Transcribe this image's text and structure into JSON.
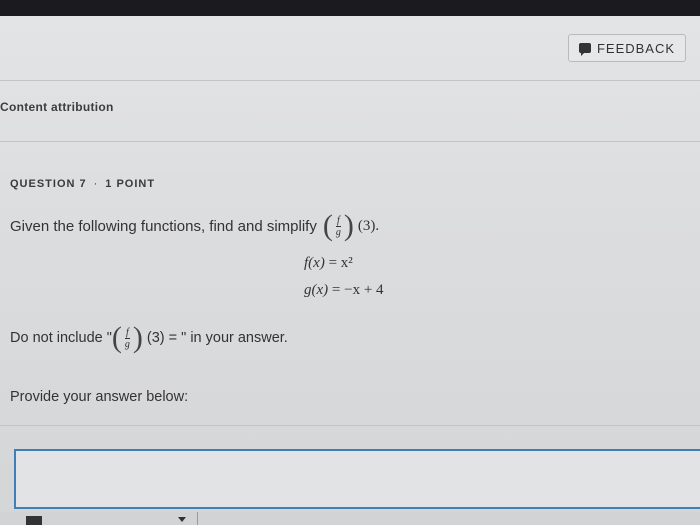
{
  "header": {
    "feedback_label": "FEEDBACK"
  },
  "attribution": {
    "label": "Content attribution"
  },
  "question": {
    "number_label": "QUESTION 7",
    "points_label": "1 POINT",
    "prompt_text": "Given the following functions, find and simplify",
    "prompt_numerator": "f",
    "prompt_denominator": "g",
    "prompt_argument": "(3).",
    "eq1_lhs": "f(x)",
    "eq1_rhs": "= x²",
    "eq2_lhs": "g(x)",
    "eq2_rhs": "= −x + 4",
    "note_prefix": "Do not include \"",
    "note_numerator": "f",
    "note_denominator": "g",
    "note_suffix": "(3) = \" in your answer."
  },
  "answer": {
    "provide_label": "Provide your answer below:",
    "value": ""
  },
  "colors": {
    "answer_border": "#3f7fb8",
    "topbar": "#1b1b1f"
  },
  "icons": {
    "feedback": "feedback-icon"
  }
}
